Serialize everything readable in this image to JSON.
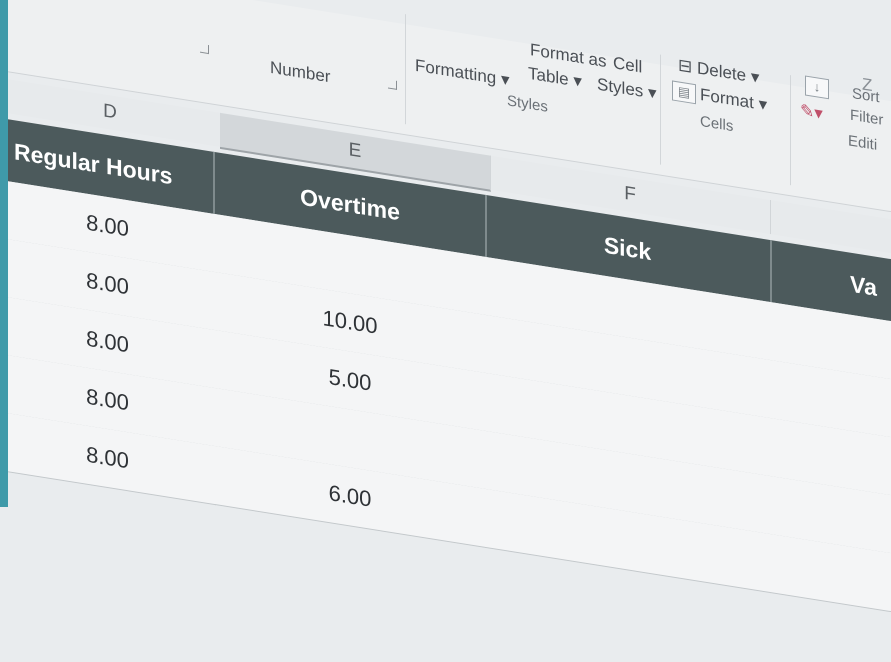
{
  "ribbon": {
    "number_group": "Number",
    "formatting": "Formatting",
    "format_as": "Format as",
    "table": "Table",
    "cell": "Cell",
    "styles_btn": "Styles",
    "styles_group": "Styles",
    "delete": "Delete",
    "format": "Format",
    "cells_group": "Cells",
    "sort": "Sort",
    "filter": "Filter",
    "editing_group": "Editi"
  },
  "columns": {
    "d": "D",
    "e": "E",
    "f": "F"
  },
  "table": {
    "headers": [
      "Regular Hours",
      "Overtime",
      "Sick",
      "Va"
    ],
    "rows": [
      [
        "8.00",
        "",
        "",
        ""
      ],
      [
        "8.00",
        "10.00",
        "",
        ""
      ],
      [
        "8.00",
        "5.00",
        "",
        ""
      ],
      [
        "8.00",
        "",
        "",
        ""
      ],
      [
        "8.00",
        "6.00",
        "",
        ""
      ]
    ]
  }
}
